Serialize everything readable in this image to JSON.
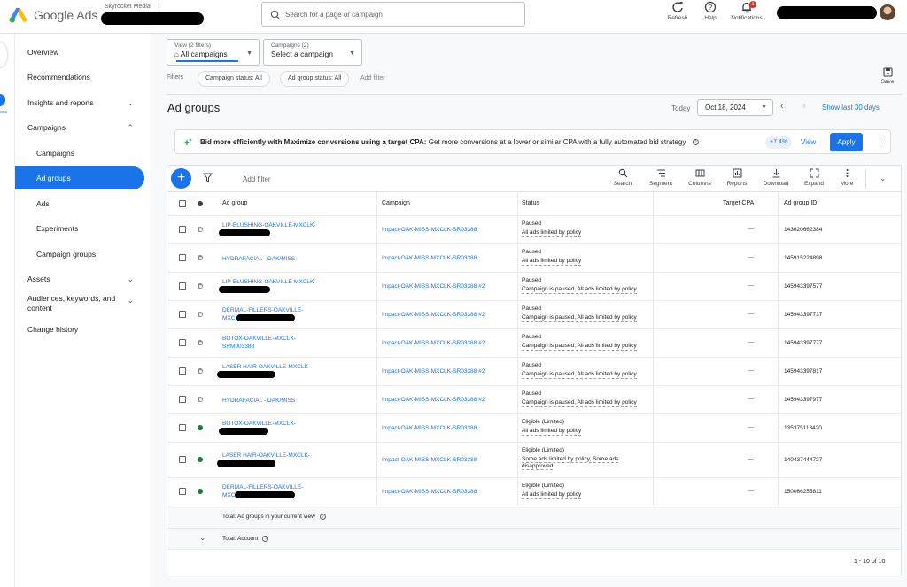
{
  "app": {
    "brand": "Google Ads",
    "account_name": "Skyrocket Media",
    "search_placeholder": "Search for a page or campaign",
    "refresh_label": "Refresh",
    "help_label": "Help",
    "notifications_label": "Notifications",
    "notifications_count": "1"
  },
  "sidebar": {
    "items": [
      {
        "label": "Overview"
      },
      {
        "label": "Recommendations"
      },
      {
        "label": "Insights and reports"
      },
      {
        "label": "Campaigns"
      },
      {
        "label": "Campaigns"
      },
      {
        "label": "Ad groups"
      },
      {
        "label": "Ads"
      },
      {
        "label": "Experiments"
      },
      {
        "label": "Campaign groups"
      },
      {
        "label": "Assets"
      },
      {
        "label": "Audiences, keywords, and content"
      },
      {
        "label": "Change history"
      }
    ],
    "rail_label": "ons"
  },
  "filters": {
    "view_label": "View (2 filters)",
    "view_value": "All campaigns",
    "campaigns_label": "Campaigns (2)",
    "campaigns_value": "Select a campaign",
    "filters_label": "Filters",
    "chips": [
      "Campaign status: All",
      "Ad group status: All"
    ],
    "add_filter": "Add filter",
    "save_label": "Save"
  },
  "page": {
    "title": "Ad groups",
    "today_label": "Today",
    "date": "Oct 18, 2024",
    "show_last": "Show last 30 days"
  },
  "banner": {
    "bold": "Bid more efficiently with Maximize conversions using a target CPA:",
    "text": "Get more conversions at a lower or similar CPA with a fully automated bid strategy",
    "percent": "+7.4%",
    "view": "View",
    "apply": "Apply"
  },
  "toolbar": {
    "add_filter": "Add filter",
    "tools": [
      "Search",
      "Segment",
      "Columns",
      "Reports",
      "Download",
      "Expand",
      "More"
    ]
  },
  "table": {
    "headers": {
      "ad_group": "Ad group",
      "campaign": "Campaign",
      "status": "Status",
      "target_cpa": "Target CPA",
      "ad_group_id": "Ad group ID"
    },
    "rows": [
      {
        "ad_group": "LIP-BLUSHING-OAKVILLE-MXCLK-",
        "campaign": "Impact-OAK-MISS-MXCLK-SR03388",
        "status": "Paused",
        "reason": "All ads limited by policy",
        "target_cpa": "—",
        "id": "143620662384",
        "state": "paused"
      },
      {
        "ad_group": "HYDRAFACIAL - OAK/MISS",
        "campaign": "Impact-OAK-MISS-MXCLK-SR03388",
        "status": "Paused",
        "reason": "All ads limited by policy",
        "target_cpa": "—",
        "id": "145915224898",
        "state": "paused"
      },
      {
        "ad_group": "LIP-BLUSHING-OAKVILLE-MXCLK-",
        "campaign": "Impact-OAK-MISS-MXCLK-SR03388 #2",
        "status": "Paused",
        "reason": "Campaign is paused, All ads limited by policy",
        "target_cpa": "—",
        "id": "145943397577",
        "state": "paused"
      },
      {
        "ad_group": "DERMAL-FILLERS-OAKVILLE-MXCLK",
        "campaign": "Impact-OAK-MISS-MXCLK-SR03388 #2",
        "status": "Paused",
        "reason": "Campaign is paused, All ads limited by policy",
        "target_cpa": "—",
        "id": "145943397737",
        "state": "paused"
      },
      {
        "ad_group": "BOTOX-OAKVILLE-MXCLK-SRM003388",
        "campaign": "Impact-OAK-MISS-MXCLK-SR03388 #2",
        "status": "Paused",
        "reason": "Campaign is paused, All ads limited by policy",
        "target_cpa": "—",
        "id": "145943397777",
        "state": "paused"
      },
      {
        "ad_group": "LASER HAIR-OAKVILLE-MXCLK-",
        "campaign": "Impact-OAK-MISS-MXCLK-SR03388 #2",
        "status": "Paused",
        "reason": "Campaign is paused, All ads limited by policy",
        "target_cpa": "—",
        "id": "145943397817",
        "state": "paused"
      },
      {
        "ad_group": "HYDRAFACIAL - OAK/MISS",
        "campaign": "Impact-OAK-MISS-MXCLK-SR03388 #2",
        "status": "Paused",
        "reason": "Campaign is paused, All ads limited by policy",
        "target_cpa": "—",
        "id": "145943397977",
        "state": "paused"
      },
      {
        "ad_group": "BOTOX-OAKVILLE-MXCLK-",
        "campaign": "Impact-OAK-MISS-MXCLK-SR03388",
        "status": "Eligible (Limited)",
        "reason": "All ads limited by policy",
        "target_cpa": "—",
        "id": "135375113420",
        "state": "eligible"
      },
      {
        "ad_group": "LASER HAIR-OAKVILLE-MXCLK-",
        "campaign": "Impact-OAK-MISS-MXCLK-SR03388",
        "status": "Eligible (Limited)",
        "reason": "Some ads limited by policy, Some ads disapproved",
        "target_cpa": "—",
        "id": "140437444727",
        "state": "eligible"
      },
      {
        "ad_group": "DERMAL-FILLERS-OAKVILLE-MXCL",
        "campaign": "Impact-OAK-MISS-MXCLK-SR03388",
        "status": "Eligible (Limited)",
        "reason": "All ads limited by policy",
        "target_cpa": "—",
        "id": "150066255811",
        "state": "eligible"
      }
    ],
    "total_view": "Total: Ad groups in your current view",
    "total_account": "Total: Account",
    "pagination": "1 - 10 of 10"
  },
  "colors": {
    "accent": "#1a73e8",
    "eligible": "#188038",
    "paused": "#80868b"
  }
}
